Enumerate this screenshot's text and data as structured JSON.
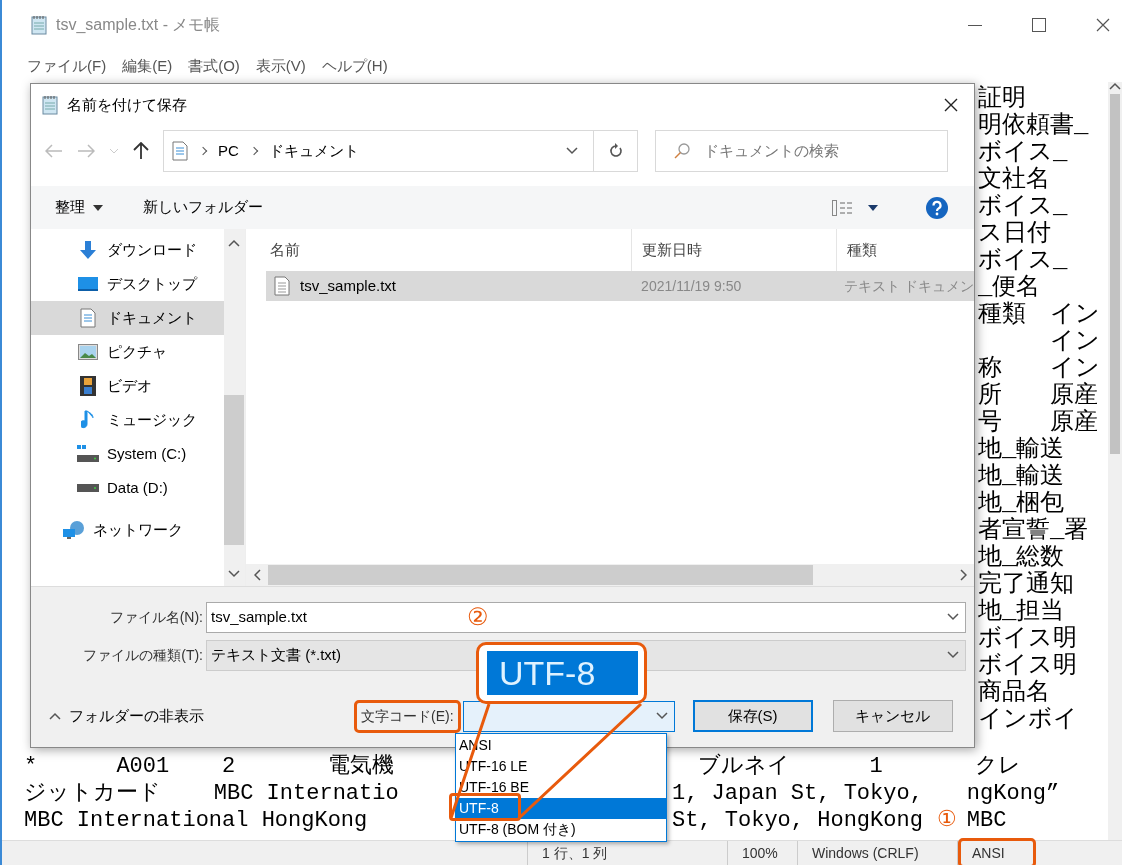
{
  "window": {
    "title": "tsv_sample.txt - メモ帳"
  },
  "menu": [
    "ファイル(F)",
    "編集(E)",
    "書式(O)",
    "表示(V)",
    "ヘルプ(H)"
  ],
  "editor": {
    "right_lines": [
      "証明",
      "明依頼書_",
      "ボイス_",
      "文社名",
      "ボイス_",
      "ス日付",
      "ボイス_",
      "_便名",
      "種類　イン",
      "　　　イン",
      "称　　イン",
      "所　　原産",
      "号　　原産",
      "地_輸送",
      "地_輸送",
      "地_梱包",
      "者宣誓_署",
      "地_総数",
      "完了通知",
      "地_担当",
      "ボイス明",
      "ボイス明",
      "商品名",
      "インボイ"
    ],
    "bottom_lines": [
      {
        "left": "*      A001    2       電気機",
        "right": [
          "  ブルネイ      1       クレ"
        ]
      },
      {
        "left": "ジットカード    MBC Internatio",
        "right": [
          "1, Japan St, Tokyo,",
          "ngKong”"
        ]
      },
      {
        "left": "MBC International HongKong",
        "right": [
          "St, Tokyo, HongKong",
          "MBC"
        ]
      }
    ]
  },
  "dialog": {
    "title": "名前を付けて保存",
    "breadcrumb": [
      "PC",
      "ドキュメント"
    ],
    "search": {
      "placeholder": "ドキュメントの検索"
    },
    "toolbar": {
      "organize": "整理",
      "new_folder": "新しいフォルダー"
    },
    "nav": [
      {
        "label": "ダウンロード",
        "kind": "download",
        "selected": false
      },
      {
        "label": "デスクトップ",
        "kind": "desktop",
        "selected": false
      },
      {
        "label": "ドキュメント",
        "kind": "document",
        "selected": true
      },
      {
        "label": "ピクチャ",
        "kind": "pictures",
        "selected": false
      },
      {
        "label": "ビデオ",
        "kind": "video",
        "selected": false
      },
      {
        "label": "ミュージック",
        "kind": "music",
        "selected": false
      },
      {
        "label": "System (C:)",
        "kind": "system-drive",
        "selected": false
      },
      {
        "label": "Data (D:)",
        "kind": "drive",
        "selected": false
      },
      {
        "label": "ネットワーク",
        "kind": "network",
        "selected": false
      }
    ],
    "columns": [
      "名前",
      "更新日時",
      "種類"
    ],
    "files": [
      {
        "name": "tsv_sample.txt",
        "modified": "2021/11/19 9:50",
        "type": "テキスト ドキュメン",
        "selected": true
      }
    ],
    "filename": {
      "label": "ファイル名(N):",
      "value": "tsv_sample.txt"
    },
    "filetype": {
      "label": "ファイルの種類(T):",
      "value": "テキスト文書 (*.txt)"
    },
    "hide_folders": "フォルダーの非表示",
    "encoding": {
      "label": "文字コード(E):",
      "options": [
        {
          "label": "ANSI",
          "selected": false
        },
        {
          "label": "UTF-16 LE",
          "selected": false
        },
        {
          "label": "UTF-16 BE",
          "selected": false
        },
        {
          "label": "UTF-8",
          "selected": true
        },
        {
          "label": "UTF-8 (BOM 付き)",
          "selected": false
        }
      ]
    },
    "buttons": [
      {
        "label": "保存(S)",
        "default": true
      },
      {
        "label": "キャンセル",
        "default": false
      }
    ]
  },
  "callout": {
    "text": "UTF-8"
  },
  "annotations": [
    "①",
    "②"
  ],
  "status_bar": [
    "1 行、1 列",
    "100%",
    "Windows (CRLF)",
    "ANSI"
  ]
}
